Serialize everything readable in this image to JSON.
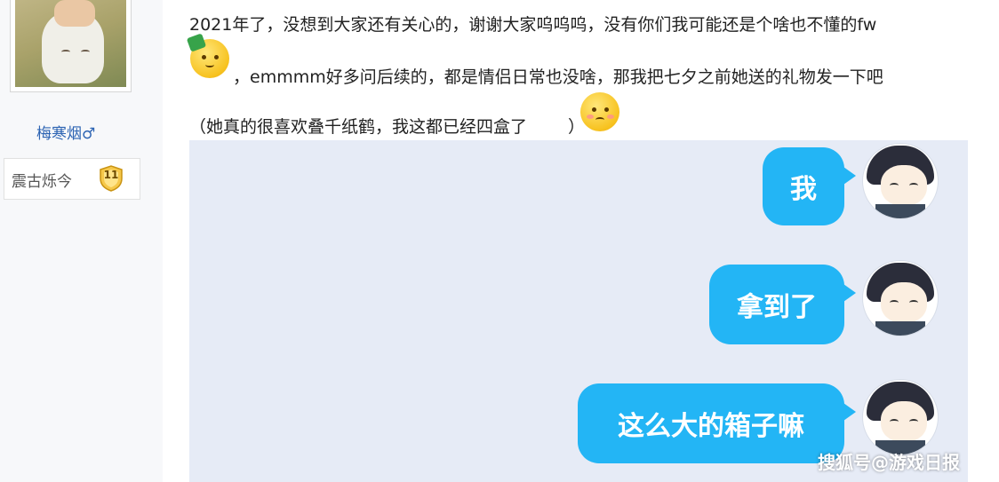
{
  "sidebar": {
    "username": "梅寒烟♂",
    "badge_label": "震古烁今",
    "level": "11"
  },
  "post": {
    "line1": "2021年了，没想到大家还有关心的，谢谢大家呜呜呜，没有你们我可能还是个啥也不懂的fw",
    "line2": "，emmmm好多问后续的，都是情侣日常也没啥，那我把七夕之前她送的礼物发一下吧",
    "line3_before": "（她真的很喜欢叠千纸鹤，我这都已经四盒了",
    "line3_after": "）"
  },
  "chat": {
    "messages": [
      {
        "text": "我"
      },
      {
        "text": "拿到了"
      },
      {
        "text": "这么大的箱子嘛"
      }
    ]
  },
  "watermark": "搜狐号@游戏日报",
  "colors": {
    "bubble": "#23b5f5",
    "chat_bg": "#e6ebf6",
    "username": "#2d64b3"
  },
  "icons": [
    "gift-face-emoji",
    "blush-face-emoji",
    "level-shield-icon"
  ]
}
